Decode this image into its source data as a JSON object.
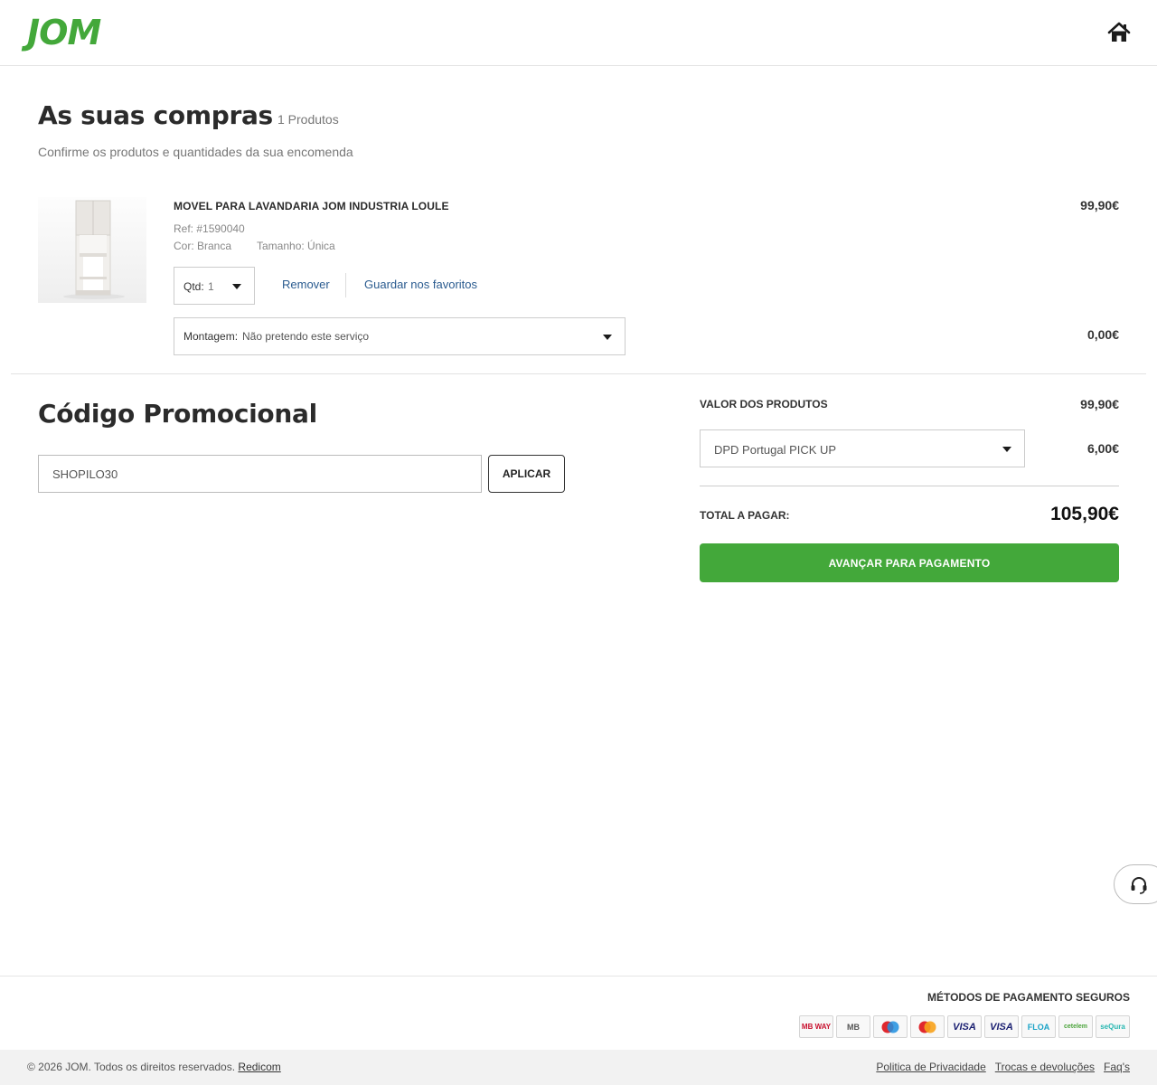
{
  "header": {
    "logo": "JOM",
    "home_icon": "home-icon"
  },
  "cart": {
    "title": "As suas compras",
    "count": "1 Produtos",
    "subtitle": "Confirme os produtos e quantidades da sua encomenda"
  },
  "product": {
    "name": "MOVEL PARA LAVANDARIA JOM INDUSTRIA LOULE",
    "ref": "Ref: #1590040",
    "color": "Cor: Branca",
    "size": "Tamanho: Única",
    "price": "99,90€",
    "qty_label": "Qtd:",
    "qty_value": "1",
    "remove_label": "Remover",
    "favorites_label": "Guardar nos favoritos",
    "assembly_label": "Montagem:",
    "assembly_value": "Não pretendo este serviço",
    "assembly_price": "0,00€"
  },
  "promo": {
    "title": "Código Promocional",
    "input_value": "SHOPILO30",
    "apply_label": "APLICAR"
  },
  "summary": {
    "products_label": "VALOR DOS PRODUTOS",
    "products_value": "99,90€",
    "shipping_value": "DPD Portugal PICK UP",
    "shipping_price": "6,00€",
    "total_label": "TOTAL A PAGAR:",
    "total_value": "105,90€",
    "checkout_label": "AVANÇAR PARA PAGAMENTO"
  },
  "support": {
    "icon": "headset-icon"
  },
  "footer": {
    "payment_title": "MÉTODOS DE PAGAMENTO SEGUROS",
    "payment_methods": [
      "MB WAY",
      "MB",
      "",
      "",
      "VISA",
      "VISA",
      "FLOA",
      "cetelem",
      "seQura"
    ],
    "copyright": "© 2026 JOM. Todos os direitos reservados.",
    "copyright_link": "Redicom",
    "links": [
      "Politica de Privacidade",
      "Trocas e devoluções",
      "Faq's"
    ]
  },
  "colors": {
    "brand_green": "#43a83a",
    "link_blue": "#2a5b8f",
    "text_dark": "#2b2b2b"
  }
}
